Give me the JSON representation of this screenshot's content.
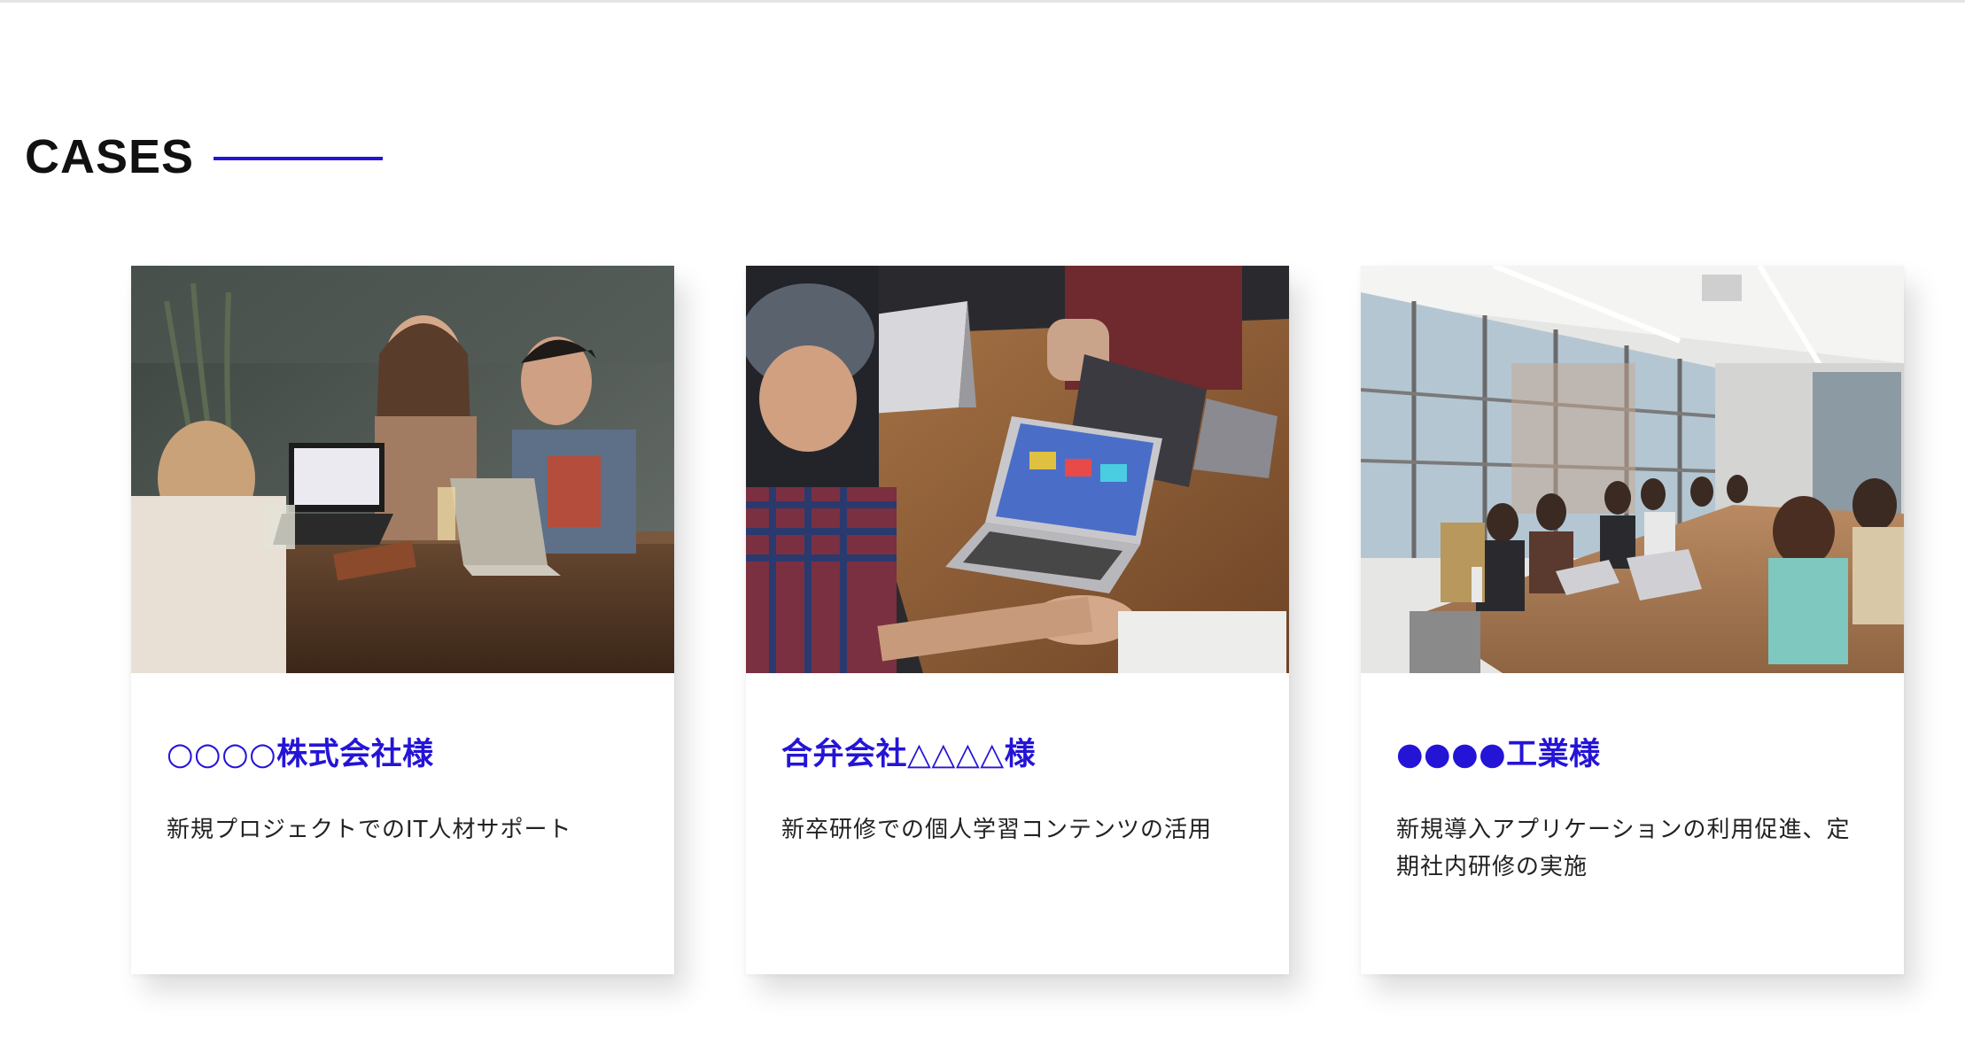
{
  "section": {
    "title": "CASES"
  },
  "colors": {
    "accent": "#2414d6",
    "text": "#222222"
  },
  "cases": [
    {
      "title": "○○○○株式会社様",
      "description": "新規プロジェクトでのIT人材サポート",
      "photo": "three people laughing at cafe table with laptops"
    },
    {
      "title": "合弁会社△△△△様",
      "description": "新卒研修での個人学習コンテンツの活用",
      "photo": "overhead view of meeting table with laptops and gesturing hands"
    },
    {
      "title": "●●●●工業様",
      "description": "新規導入アプリケーションの利用促進、定期社内研修の実施",
      "photo": "large conference room with people around long table"
    }
  ]
}
